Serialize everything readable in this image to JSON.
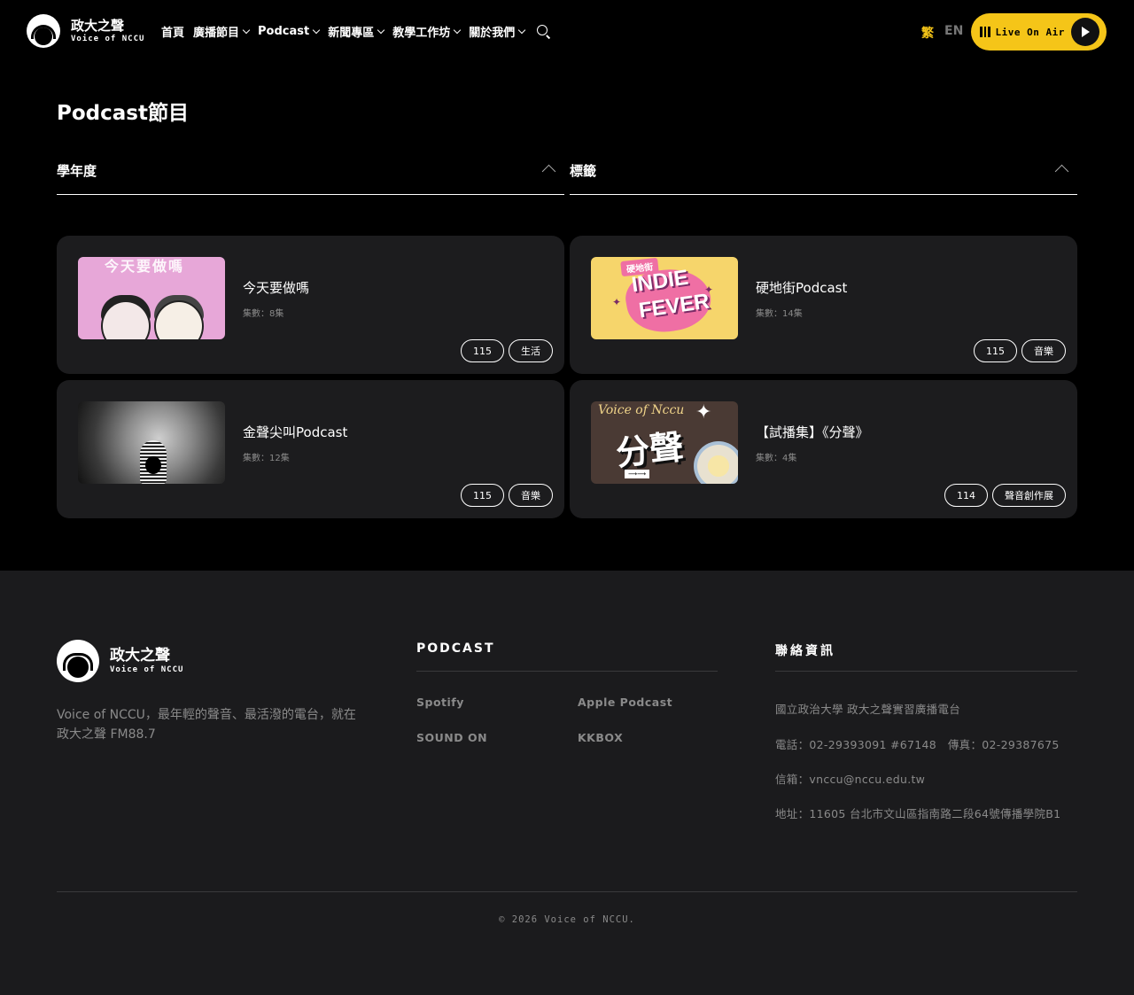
{
  "brand": {
    "name_zh": "政大之聲",
    "name_en": "Voice of NCCU"
  },
  "nav": {
    "items": [
      {
        "label": "首頁",
        "has_dropdown": false
      },
      {
        "label": "廣播節目",
        "has_dropdown": true
      },
      {
        "label": "Podcast",
        "has_dropdown": true
      },
      {
        "label": "新聞專區",
        "has_dropdown": true
      },
      {
        "label": "教學工作坊",
        "has_dropdown": true
      },
      {
        "label": "關於我們",
        "has_dropdown": true
      }
    ],
    "search_icon": "search-icon"
  },
  "lang": {
    "zh": "繁",
    "en": "EN",
    "active": "zh"
  },
  "live": {
    "label": "Live On Air",
    "icon": "play-icon"
  },
  "page": {
    "title": "Podcast節目"
  },
  "filters": {
    "year_label": "學年度",
    "tag_label": "標籤"
  },
  "podcasts": [
    {
      "title": "今天要做嗎",
      "count": "集數：8集",
      "tags": [
        "115",
        "生活"
      ],
      "thumb_text": "今天要做嗎"
    },
    {
      "title": "硬地街Podcast",
      "count": "集數：14集",
      "tags": [
        "115",
        "音樂"
      ],
      "thumb_badge": "硬地街",
      "thumb_word1": "INDIE",
      "thumb_word2": "FEVER"
    },
    {
      "title": "金聲尖叫Podcast",
      "count": "集數：12集",
      "tags": [
        "115",
        "音樂"
      ]
    },
    {
      "title": "【試播集】《分聲》",
      "count": "集數：4集",
      "tags": [
        "114",
        "聲音創作展"
      ],
      "thumb_sig": "Voice of Nccu",
      "thumb_big": "分聲"
    }
  ],
  "footer": {
    "desc": "Voice of NCCU，最年輕的聲音、最活潑的電台，就在政大之聲 FM88.7",
    "podcast_title": "PODCAST",
    "podcast_links": [
      "Spotify",
      "Apple Podcast",
      "SOUND ON",
      "KKBOX"
    ],
    "contact_title": "聯絡資訊",
    "contact": [
      "國立政治大學 政大之聲實習廣播電台",
      "電話：02-29393091 #67148　傳真：02-29387675",
      "信箱：vnccu@nccu.edu.tw",
      "地址：11605 台北市文山區指南路二段64號傳播學院B1"
    ],
    "copyright": "© 2026 Voice of NCCU."
  },
  "colors": {
    "accent": "#f5c518",
    "card_bg": "#1c1c1e",
    "footer_bg": "#1b1b1d"
  }
}
